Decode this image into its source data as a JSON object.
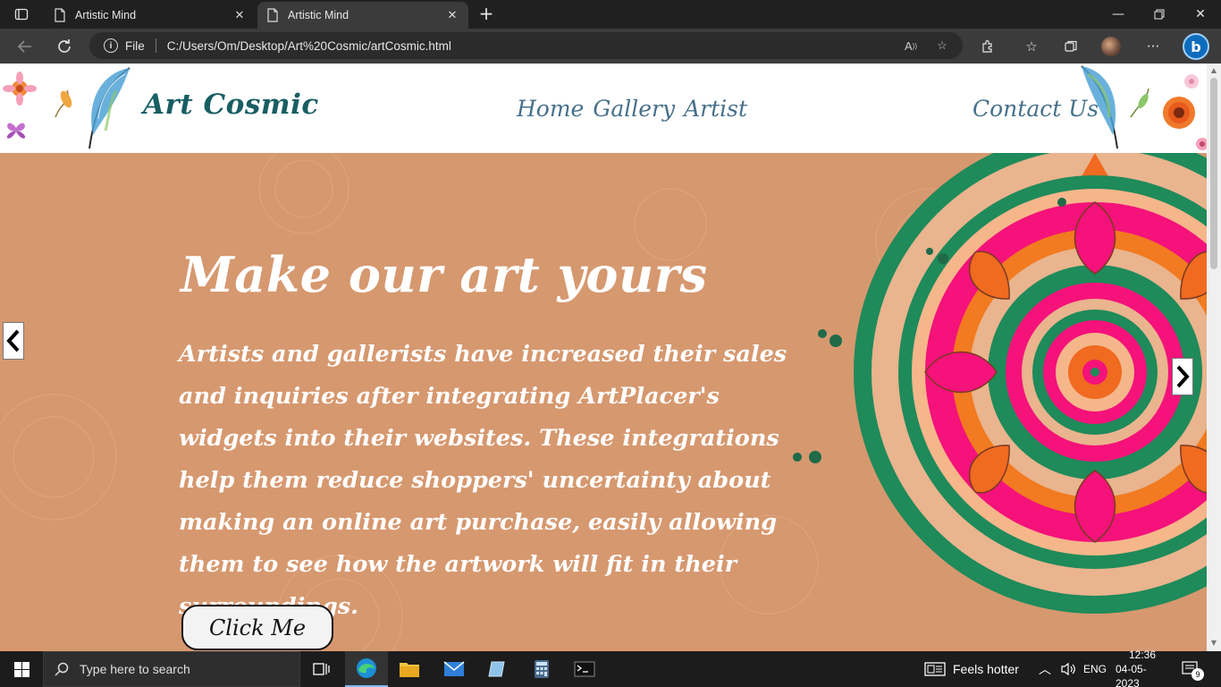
{
  "browser": {
    "tabs": [
      {
        "title": "Artistic Mind",
        "active": false
      },
      {
        "title": "Artistic Mind",
        "active": true
      }
    ],
    "address": {
      "scheme_label": "File",
      "url": "C:/Users/Om/Desktop/Art%20Cosmic/artCosmic.html"
    }
  },
  "site": {
    "brand": "Art Cosmic",
    "nav": [
      "Home",
      "Gallery",
      "Artist"
    ],
    "contact": "Contact Us"
  },
  "hero": {
    "title": "Make our art yours",
    "text": "Artists and gallerists have increased their sales and inquiries after integrating ArtPlacer's widgets into their websites. These integrations help them reduce shoppers' uncertainty about making an online art purchase, easily allowing them to see how the artwork will fit in their surroundings.",
    "button": "Click Me"
  },
  "taskbar": {
    "search_placeholder": "Type here to search",
    "weather": "Feels hotter",
    "language": "ENG",
    "time": "12:36",
    "date": "04-05-2023",
    "notifications": "9"
  },
  "colors": {
    "hero_bg": "#d6986f",
    "brand": "#185e63",
    "nav": "#46708a"
  }
}
